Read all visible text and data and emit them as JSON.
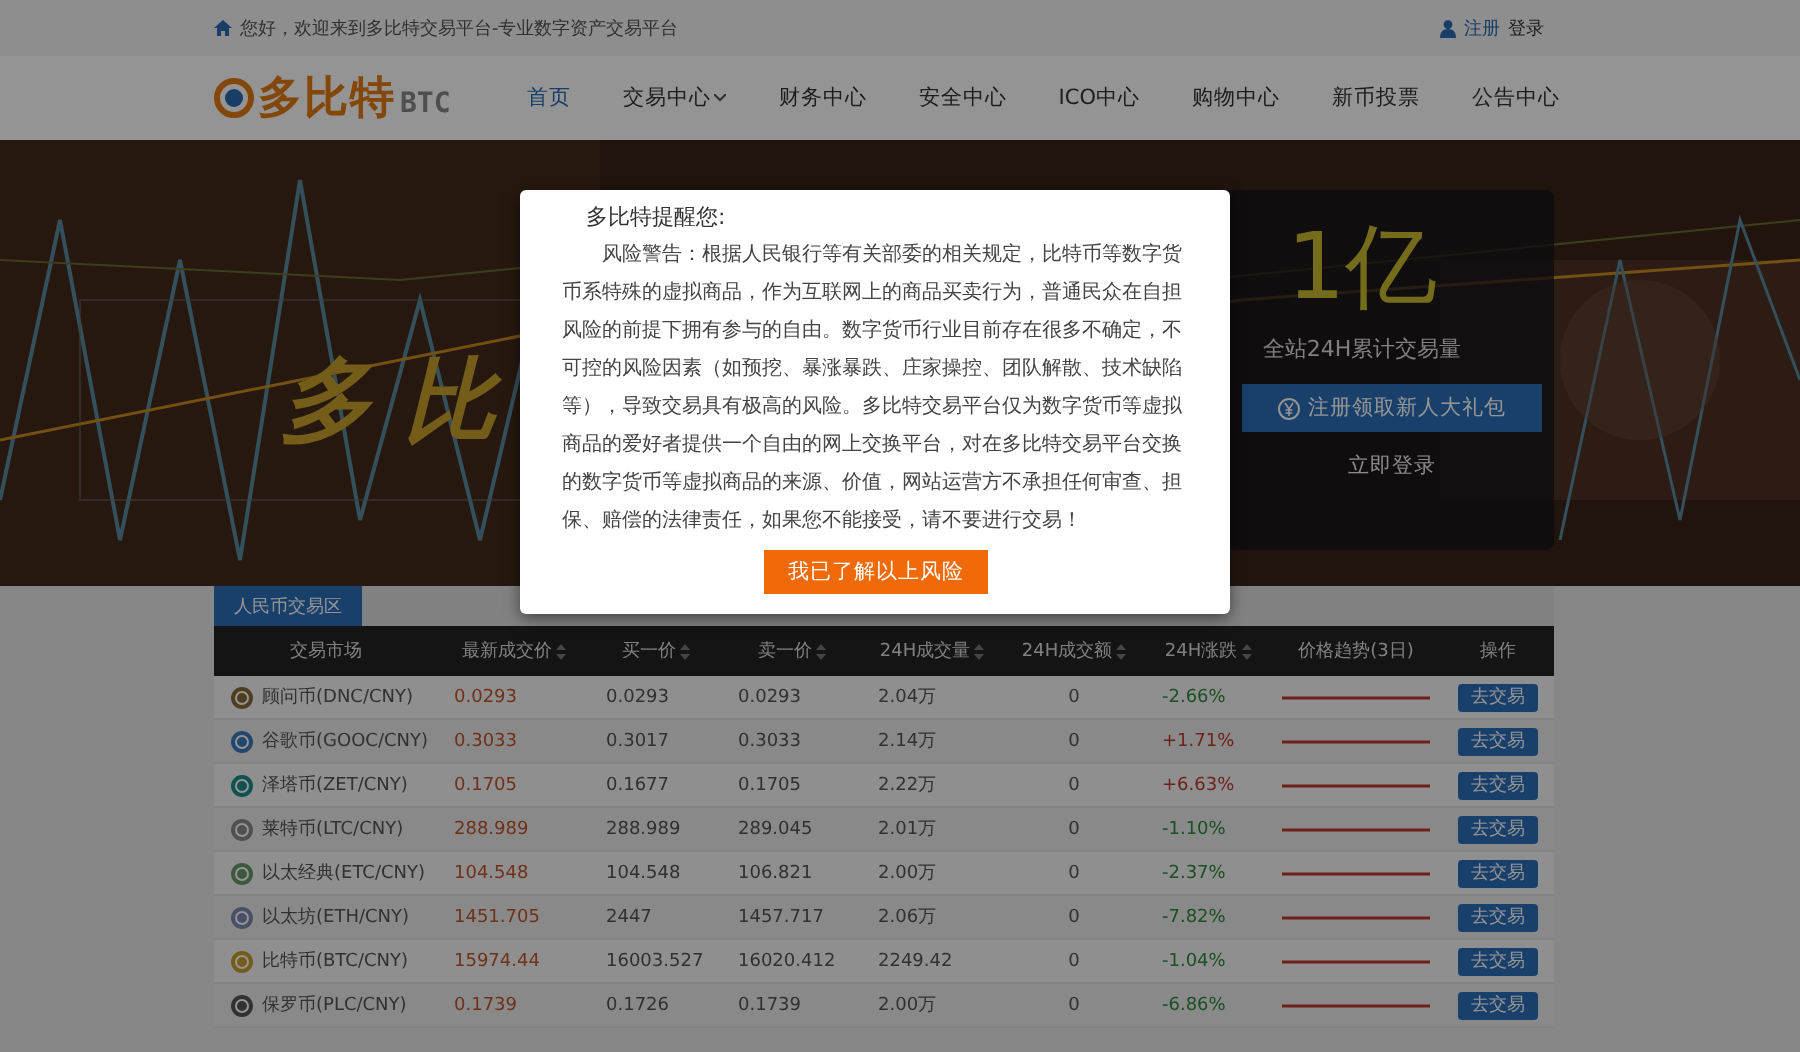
{
  "top_bar": {
    "welcome": "您好，欢迎来到多比特交易平台-专业数字资产交易平台",
    "links": [
      "注册",
      "登录"
    ]
  },
  "nav": {
    "logo": "多比特",
    "logo_suffix": "BTC",
    "items": [
      {
        "label": "首页",
        "selected": true,
        "has_menu": false
      },
      {
        "label": "交易中心",
        "selected": false,
        "has_menu": true
      },
      {
        "label": "财务中心",
        "selected": false,
        "has_menu": false
      },
      {
        "label": "安全中心",
        "selected": false,
        "has_menu": false
      },
      {
        "label": "ICO中心",
        "selected": false,
        "has_menu": false
      },
      {
        "label": "购物中心",
        "selected": false,
        "has_menu": false
      },
      {
        "label": "新币投票",
        "selected": false,
        "has_menu": false
      },
      {
        "label": "公告中心",
        "selected": false,
        "has_menu": false
      }
    ]
  },
  "banner": {
    "slogan": "多比",
    "stat": "1亿",
    "stat_label": "全站24H累计交易量",
    "register_button": "注册领取新人大礼包",
    "login_link": "立即登录"
  },
  "market": {
    "tab": "人民币交易区",
    "columns": [
      {
        "label": "交易市场",
        "sortable": false
      },
      {
        "label": "最新成交价",
        "sortable": true
      },
      {
        "label": "买一价",
        "sortable": true
      },
      {
        "label": "卖一价",
        "sortable": true
      },
      {
        "label": "24H成交量",
        "sortable": true
      },
      {
        "label": "24H成交额",
        "sortable": true
      },
      {
        "label": "24H涨跌",
        "sortable": true
      },
      {
        "label": "价格趋势(3日)",
        "sortable": false
      },
      {
        "label": "操作",
        "sortable": false
      }
    ],
    "rows": [
      {
        "market": "顾问币(DNC/CNY)",
        "price": "0.0293",
        "buy": "0.0293",
        "sell": "0.0293",
        "volume": "2.04万",
        "amount": "0",
        "change": "-2.66%",
        "rising": false,
        "action": "去交易"
      },
      {
        "market": "谷歌币(GOOC/CNY)",
        "price": "0.3033",
        "buy": "0.3017",
        "sell": "0.3033",
        "volume": "2.14万",
        "amount": "0",
        "change": "+1.71%",
        "rising": true,
        "action": "去交易"
      },
      {
        "market": "泽塔币(ZET/CNY)",
        "price": "0.1705",
        "buy": "0.1677",
        "sell": "0.1705",
        "volume": "2.22万",
        "amount": "0",
        "change": "+6.63%",
        "rising": true,
        "action": "去交易"
      },
      {
        "market": "莱特币(LTC/CNY)",
        "price": "288.989",
        "buy": "288.989",
        "sell": "289.045",
        "volume": "2.01万",
        "amount": "0",
        "change": "-1.10%",
        "rising": false,
        "action": "去交易"
      },
      {
        "market": "以太经典(ETC/CNY)",
        "price": "104.548",
        "buy": "104.548",
        "sell": "106.821",
        "volume": "2.00万",
        "amount": "0",
        "change": "-2.37%",
        "rising": false,
        "action": "去交易"
      },
      {
        "market": "以太坊(ETH/CNY)",
        "price": "1451.705",
        "buy": "2447",
        "sell": "1457.717",
        "volume": "2.06万",
        "amount": "0",
        "change": "-7.82%",
        "rising": false,
        "action": "去交易"
      },
      {
        "market": "比特币(BTC/CNY)",
        "price": "15974.44",
        "buy": "16003.527",
        "sell": "16020.412",
        "volume": "2249.42",
        "amount": "0",
        "change": "-1.04%",
        "rising": false,
        "action": "去交易"
      },
      {
        "market": "保罗币(PLC/CNY)",
        "price": "0.1739",
        "buy": "0.1726",
        "sell": "0.1739",
        "volume": "2.00万",
        "amount": "0",
        "change": "-6.86%",
        "rising": false,
        "action": "去交易"
      }
    ]
  },
  "dialog": {
    "title": "多比特提醒您:",
    "message": "风险警告：根据人民银行等有关部委的相关规定，比特币等数字货币系特殊的虚拟商品，作为互联网上的商品买卖行为，普通民众在自担风险的前提下拥有参与的自由。数字货币行业目前存在很多不确定，不可控的风险因素（如预挖、暴涨暴跌、庄家操控、团队解散、技术缺陷等），导致交易具有极高的风险。多比特交易平台仅为数字货币等虚拟商品的爱好者提供一个自由的网上交换平台，对在多比特交易平台交换的数字货币等虚拟商品的来源、价值，网站运营方不承担任何审查、担保、赔偿的法律责任，如果您不能接受，请不要进行交易！",
    "button": "我已了解以上风险"
  }
}
